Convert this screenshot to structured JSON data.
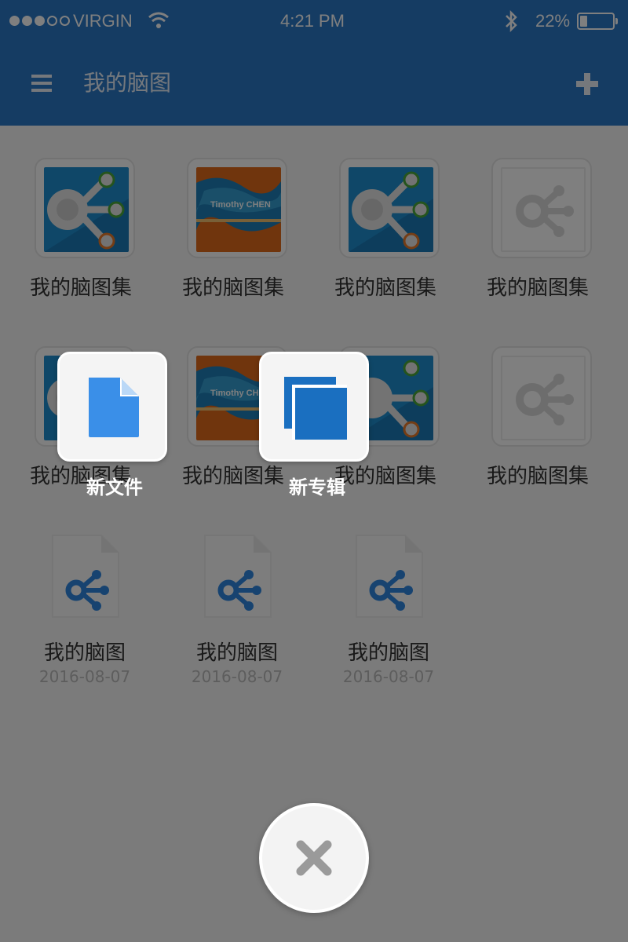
{
  "status_bar": {
    "carrier": "VIRGIN",
    "time": "4:21 PM",
    "battery": "22%",
    "battery_level": 0.22,
    "icons": [
      "signal-dots-icon",
      "wifi-icon",
      "bluetooth-icon",
      "battery-icon"
    ]
  },
  "app_bar": {
    "title": "我的脑图",
    "menu_icon": "hamburger-menu-icon",
    "add_icon": "plus-icon"
  },
  "albums": [
    {
      "label": "我的脑图集",
      "thumb": "blue-mindmap"
    },
    {
      "label": "我的脑图集",
      "thumb": "orange-photo",
      "photo_text": "Timothy CHEN"
    },
    {
      "label": "我的脑图集",
      "thumb": "blue-mindmap"
    },
    {
      "label": "我的脑图集",
      "thumb": "empty"
    },
    {
      "label": "我的脑图集",
      "thumb": "blue-mindmap"
    },
    {
      "label": "我的脑图集",
      "thumb": "orange-photo",
      "photo_text": "Timothy CHEN"
    },
    {
      "label": "我的脑图集",
      "thumb": "blue-mindmap"
    },
    {
      "label": "我的脑图集",
      "thumb": "empty"
    }
  ],
  "files": [
    {
      "name": "我的脑图",
      "date": "2016-08-07"
    },
    {
      "name": "我的脑图",
      "date": "2016-08-07"
    },
    {
      "name": "我的脑图",
      "date": "2016-08-07"
    }
  ],
  "actions": {
    "new_file": "新文件",
    "new_album": "新专辑"
  },
  "colors": {
    "primary": "#2a78c7",
    "accent_blue": "#3a8fe8",
    "overlay": "rgba(0,0,0,0.5)"
  }
}
